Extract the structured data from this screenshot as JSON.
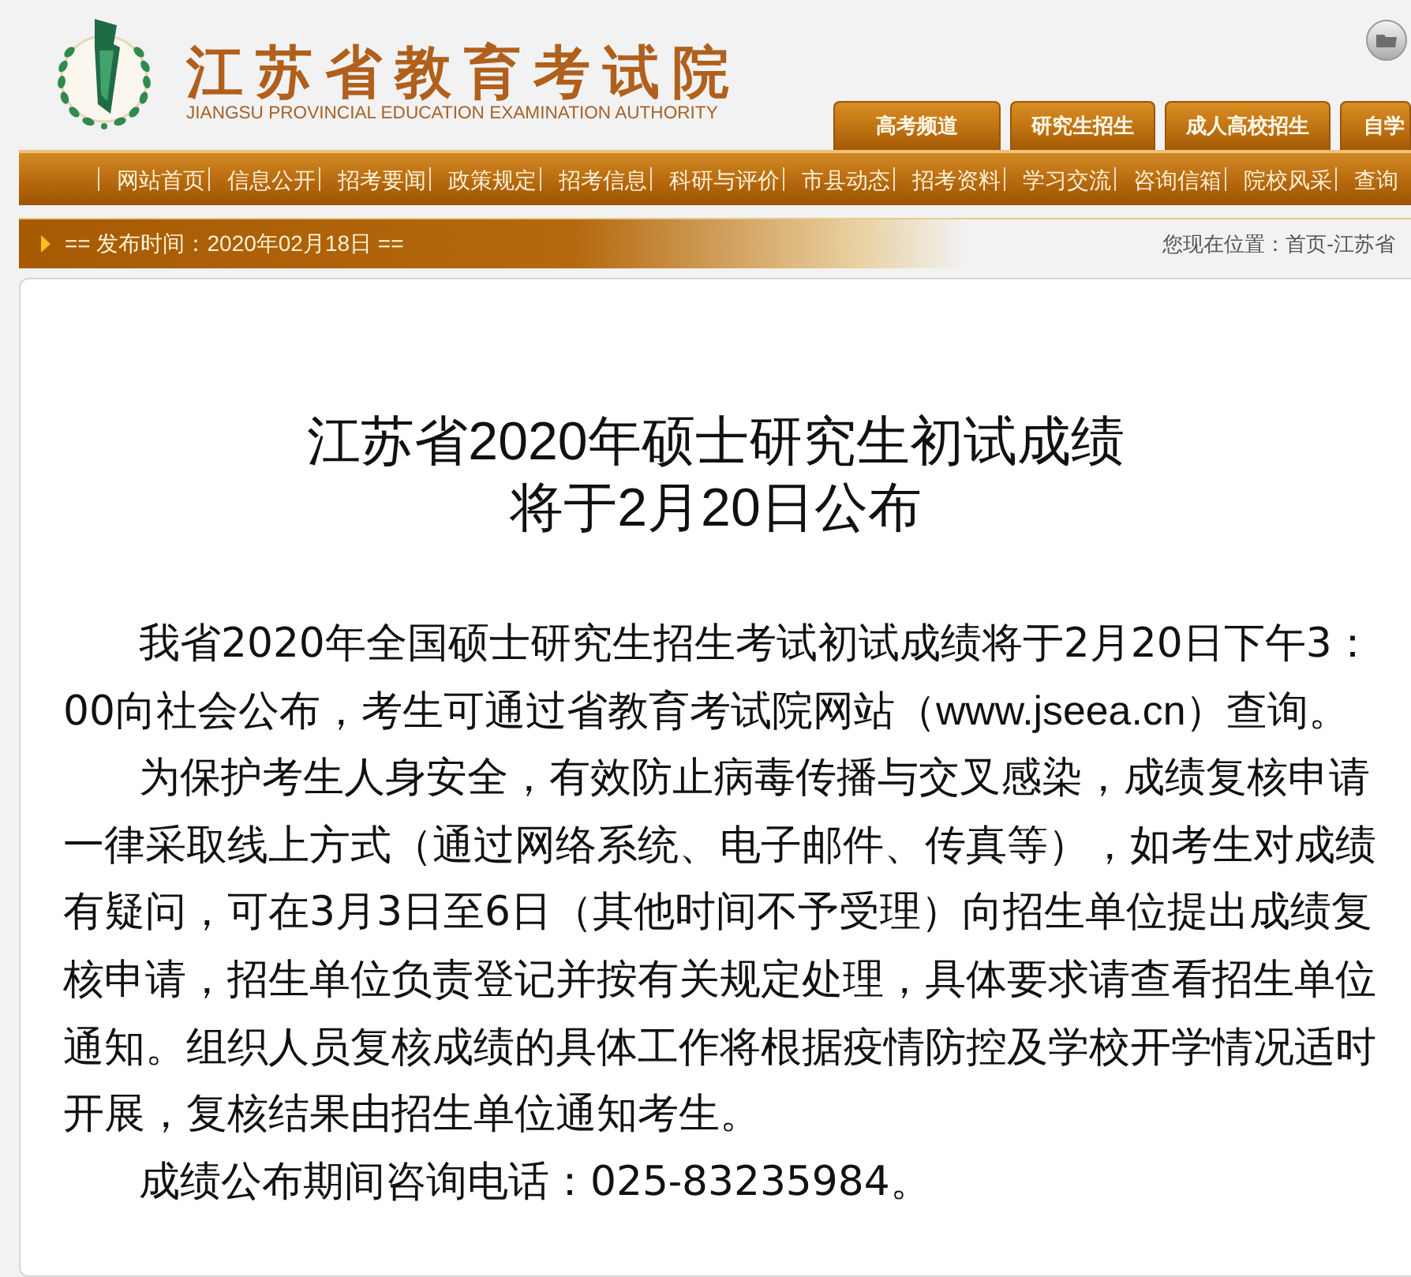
{
  "header": {
    "title": "江苏省教育考试院",
    "subtitle": "JIANGSU PROVINCIAL EDUCATION EXAMINATION AUTHORITY"
  },
  "channel_tabs": [
    {
      "label": "高考频道"
    },
    {
      "label": "研究生招生"
    },
    {
      "label": "成人高校招生"
    },
    {
      "label": "自学"
    }
  ],
  "nav_bar": {
    "items": [
      "网站首页",
      "信息公开",
      "招考要闻",
      "政策规定",
      "招考信息",
      "科研与评价",
      "市县动态",
      "招考资料",
      "学习交流",
      "咨询信箱",
      "院校风采",
      "查询"
    ]
  },
  "date_bar": {
    "text": "== 发布时间：2020年02月18日 ==",
    "breadcrumb": "您现在位置：首页-江苏省"
  },
  "article": {
    "title_lines": [
      "江苏省2020年硕士研究生初试成绩",
      "将于2月20日公布"
    ],
    "paragraphs": [
      "我省2020年全国硕士研究生招生考试初试成绩将于2月20日下午3：00向社会公布，考生可通过省教育考试院网站（www.jseea.cn）查询。",
      "为保护考生人身安全，有效防止病毒传播与交叉感染，成绩复核申请一律采取线上方式（通过网络系统、电子邮件、传真等），如考生对成绩有疑问，可在3月3日至6日（其他时间不予受理）向招生单位提出成绩复核申请，招生单位负责登记并按有关规定处理，具体要求请查看招生单位通知。组织人员复核成绩的具体工作将根据疫情防控及学校开学情况适时开展，复核结果由招生单位通知考生。",
      "成绩公布期间咨询电话：025-83235984。"
    ]
  }
}
